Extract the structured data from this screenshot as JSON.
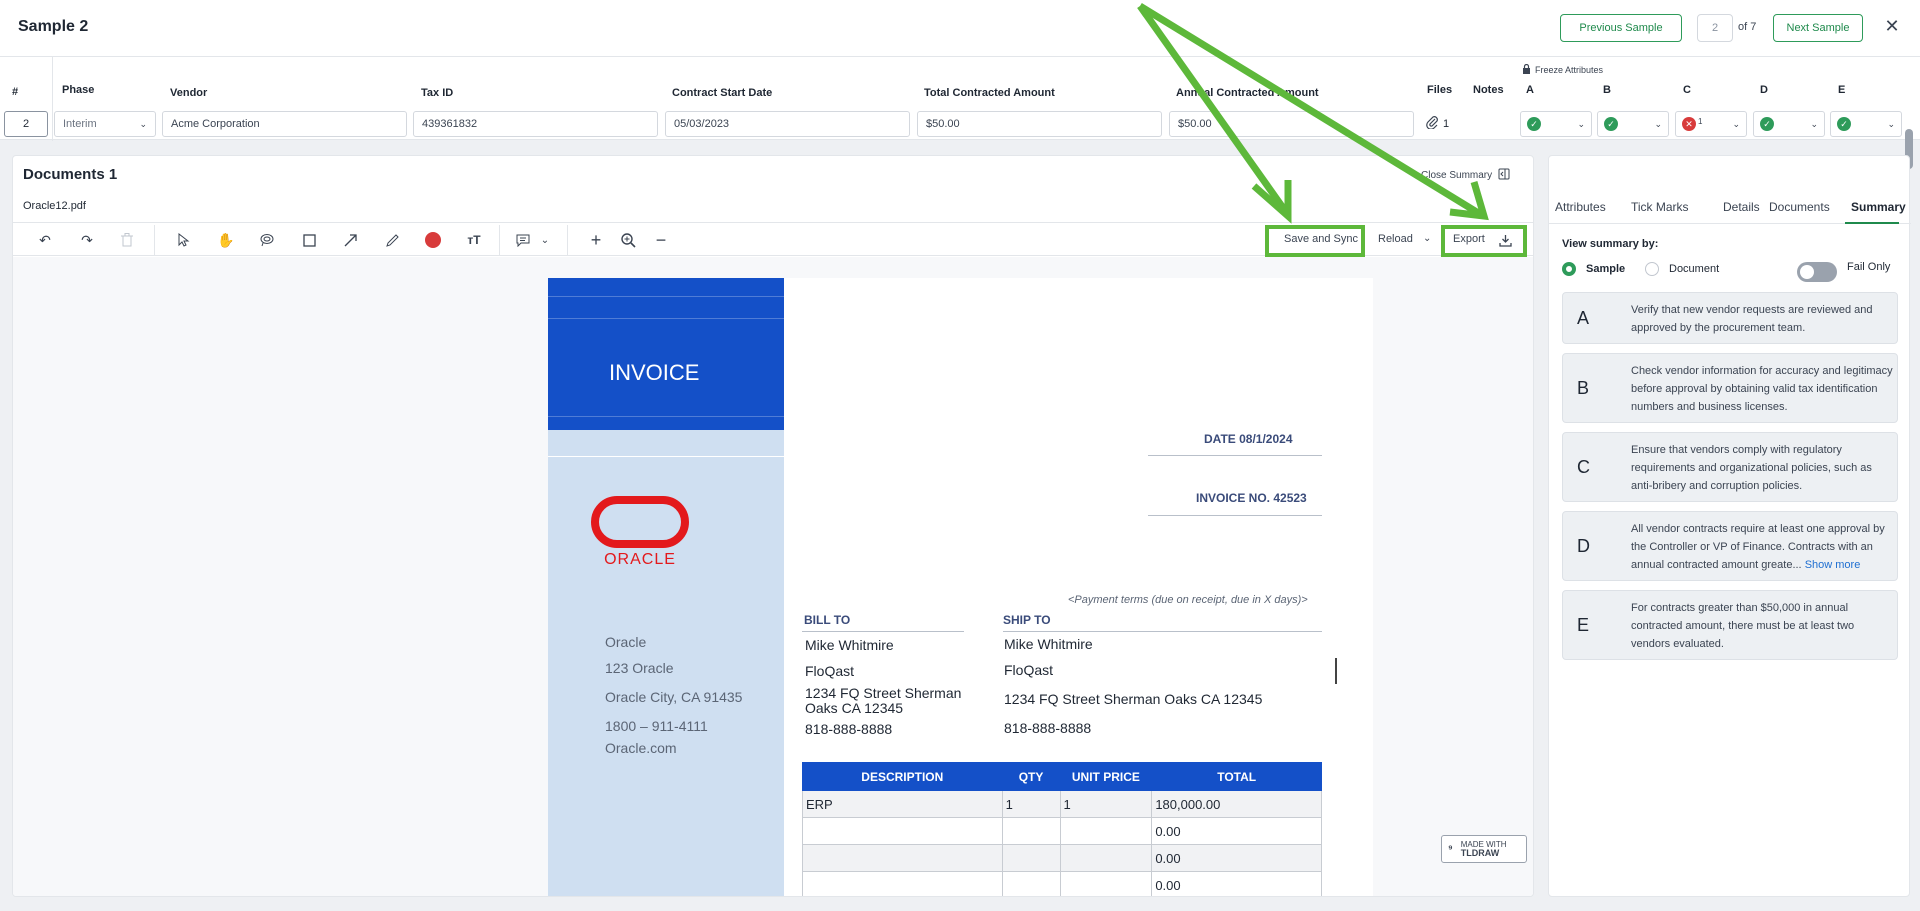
{
  "header": {
    "title": "Sample 2",
    "prev_label": "Previous Sample",
    "page_current": "2",
    "page_of": "of 7",
    "next_label": "Next Sample",
    "close_glyph": "✕"
  },
  "grid": {
    "freeze_label": "Freeze Attributes",
    "columns": {
      "num": "#",
      "phase": "Phase",
      "vendor": "Vendor",
      "tax_id": "Tax ID",
      "contract_start": "Contract Start Date",
      "total_contracted": "Total Contracted Amount",
      "annual_contracted": "Annual Contracted Amount",
      "files": "Files",
      "notes": "Notes",
      "a": "A",
      "b": "B",
      "c": "C",
      "d": "D",
      "e": "E"
    },
    "row": {
      "num": "2",
      "phase": "Interim",
      "vendor": "Acme Corporation",
      "tax_id": "439361832",
      "contract_start": "05/03/2023",
      "total_contracted": "$50.00",
      "annual_contracted": "$50.00",
      "files_count": "1",
      "c_badge": "1",
      "attributes": {
        "a": "pass",
        "b": "pass",
        "c": "fail",
        "d": "pass",
        "e": "pass"
      }
    }
  },
  "documents": {
    "title": "Documents 1",
    "filename": "Oracle12.pdf",
    "close_summary": "Close Summary",
    "toolbar": {
      "save_sync": "Save and Sync",
      "reload": "Reload",
      "export": "Export"
    },
    "icons": [
      "undo-icon",
      "redo-icon",
      "trash-icon",
      "select-icon",
      "hand-icon",
      "lasso-icon",
      "rectangle-icon",
      "arrow-icon",
      "pencil-icon",
      "color-dot-icon",
      "text-size-icon",
      "comment-icon",
      "plus-icon",
      "zoom-in-icon",
      "minus-icon"
    ],
    "highlight_color": "#5db83a",
    "watermark_top": "MADE WITH",
    "watermark_bottom": "TLDRAW"
  },
  "invoice": {
    "title": "INVOICE",
    "logo_text": "ORACLE",
    "brand_color": "#1450c8",
    "logo_color": "#e3191c",
    "company": {
      "name": "Oracle",
      "street": "123 Oracle",
      "city": "Oracle City, CA 91435",
      "phone": "1800 – 911-4111",
      "web": "Oracle.com"
    },
    "date": "DATE 08/1/2024",
    "number": "INVOICE NO. 42523",
    "payment_terms": "<Payment terms (due on receipt, due in X days)>",
    "bill_to_label": "BILL TO",
    "ship_to_label": "SHIP TO",
    "bill_to": {
      "name": "Mike Whitmire",
      "company": "FloQast",
      "address": "1234 FQ Street Sherman Oaks CA 12345",
      "phone": "818-888-8888"
    },
    "ship_to": {
      "name": "Mike Whitmire",
      "company": "FloQast",
      "address": "1234 FQ Street Sherman Oaks CA 12345",
      "phone": "818-888-8888"
    },
    "table_headers": [
      "DESCRIPTION",
      "QTY",
      "UNIT PRICE",
      "TOTAL"
    ],
    "rows": [
      [
        "ERP",
        "1",
        "1",
        "180,000.00"
      ],
      [
        "",
        "",
        "",
        "0.00"
      ],
      [
        "",
        "",
        "",
        "0.00"
      ],
      [
        "",
        "",
        "",
        "0.00"
      ]
    ]
  },
  "summary": {
    "tabs": [
      "Attributes",
      "Tick Marks",
      "Details",
      "Documents",
      "Summary"
    ],
    "active_tab": "Summary",
    "view_by_label": "View summary by:",
    "option_sample": "Sample",
    "option_document": "Document",
    "fail_only": "Fail Only",
    "cards": [
      {
        "letter": "A",
        "text": "Verify that new vendor requests are reviewed and approved by the procurement team."
      },
      {
        "letter": "B",
        "text": "Check vendor information for accuracy and legitimacy before approval by obtaining valid tax identification numbers and business licenses."
      },
      {
        "letter": "C",
        "text": "Ensure that vendors comply with regulatory requirements and organizational policies, such as anti-bribery and corruption policies."
      },
      {
        "letter": "D",
        "text": "All vendor contracts require at least one approval by the Controller or VP of Finance. Contracts with an annual contracted amount greate...",
        "more": "Show more"
      },
      {
        "letter": "E",
        "text": "For contracts greater than $50,000 in annual contracted amount, there must be at least two vendors evaluated."
      }
    ]
  }
}
